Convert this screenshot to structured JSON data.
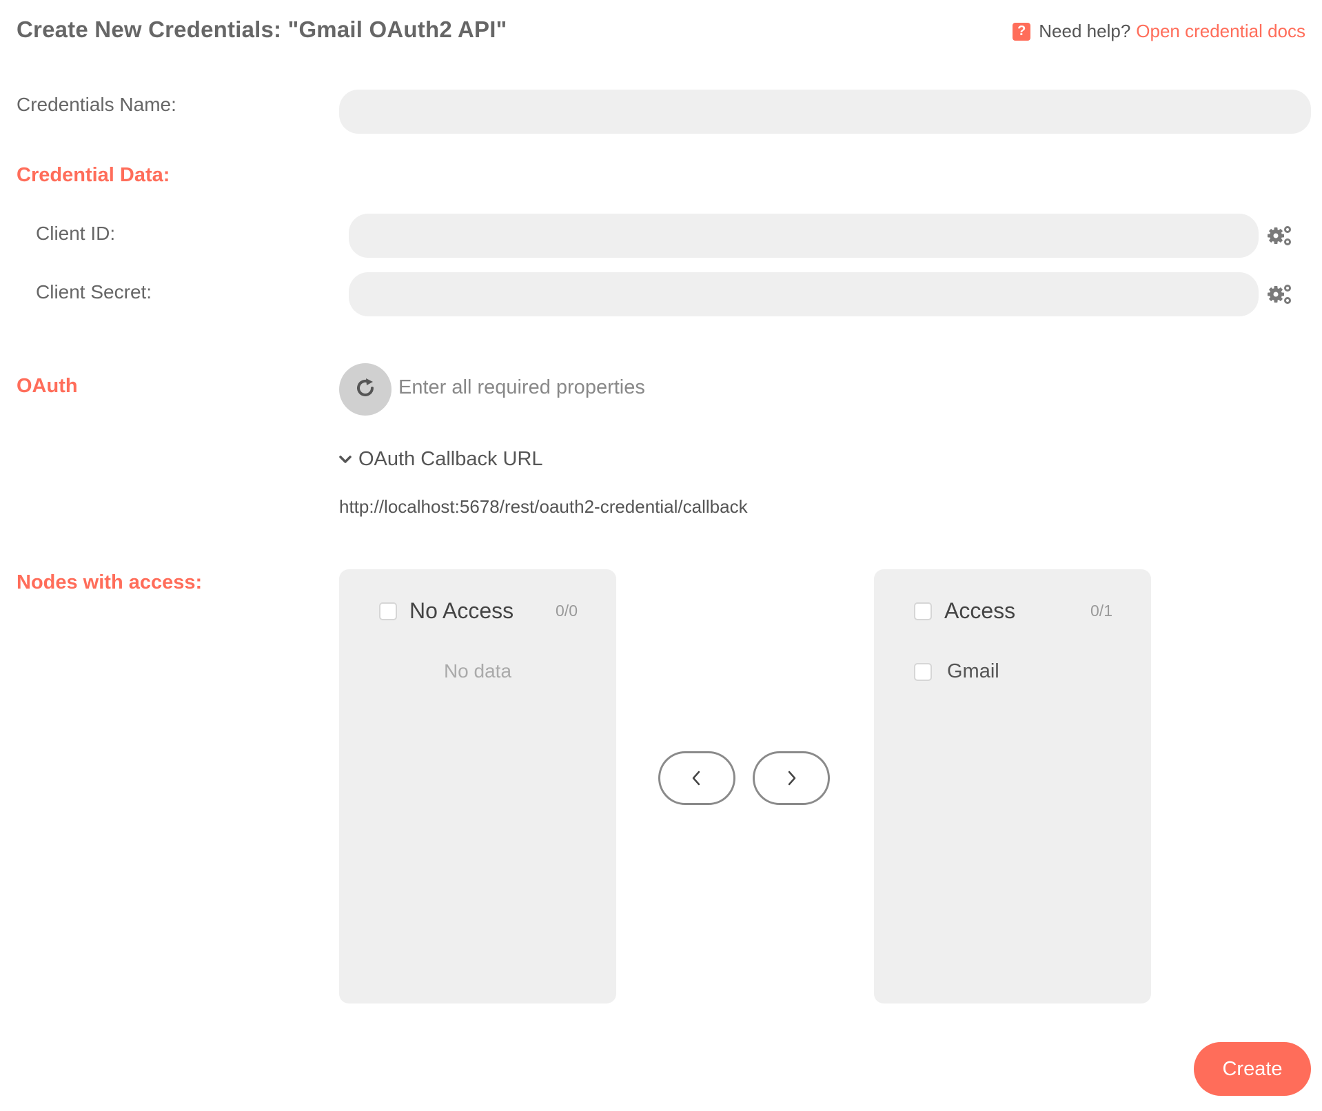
{
  "header": {
    "title": "Create New Credentials: \"Gmail OAuth2 API\"",
    "help_icon": "?",
    "help_text": "Need help?",
    "help_link": "Open credential docs"
  },
  "form": {
    "credentials_name_label": "Credentials Name:",
    "credentials_name_value": "",
    "credential_data_heading": "Credential Data:",
    "client_id_label": "Client ID:",
    "client_id_value": "",
    "client_secret_label": "Client Secret:",
    "client_secret_value": ""
  },
  "oauth": {
    "heading": "OAuth",
    "status": "Enter all required properties",
    "callback_toggle": "OAuth Callback URL",
    "callback_url": "http://localhost:5678/rest/oauth2-credential/callback"
  },
  "nodes_access": {
    "heading": "Nodes with access:",
    "no_access": {
      "title": "No Access",
      "count": "0/0",
      "empty_text": "No data",
      "items": []
    },
    "access": {
      "title": "Access",
      "count": "0/1",
      "items": [
        {
          "label": "Gmail"
        }
      ]
    }
  },
  "actions": {
    "create_label": "Create"
  },
  "colors": {
    "accent": "#ff6d5a",
    "input_bg": "#efefef",
    "panel_bg": "#efefef"
  }
}
